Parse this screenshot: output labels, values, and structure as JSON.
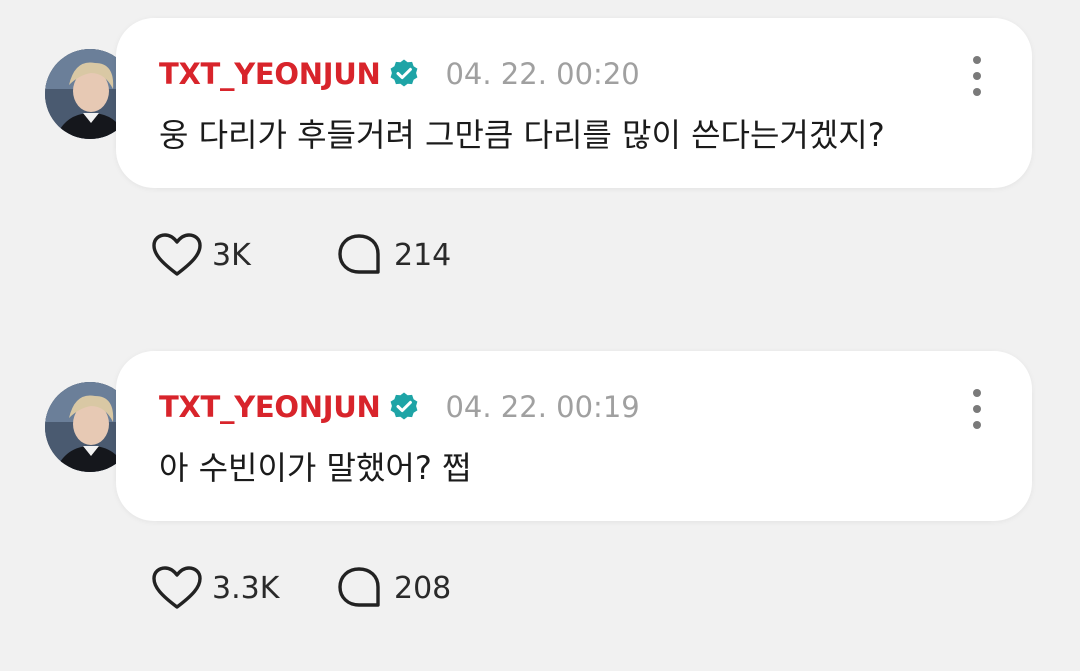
{
  "accent_colors": {
    "author": "#d8242b",
    "verified_badge": "#1ea4a6",
    "timestamp": "#a0a0a0",
    "background": "#f1f1f1",
    "bubble": "#ffffff"
  },
  "posts": [
    {
      "author": "TXT_YEONJUN",
      "verified_icon": "verified-badge-icon",
      "timestamp": "04. 22. 00:20",
      "message": "웅 다리가 후들거려 그만큼 다리를 많이 쓴다는거겠지?",
      "likes": "3K",
      "replies": "214"
    },
    {
      "author": "TXT_YEONJUN",
      "verified_icon": "verified-badge-icon",
      "timestamp": "04. 22. 00:19",
      "message": "아 수빈이가 말했어? 쩝",
      "likes": "3.3K",
      "replies": "208"
    }
  ]
}
